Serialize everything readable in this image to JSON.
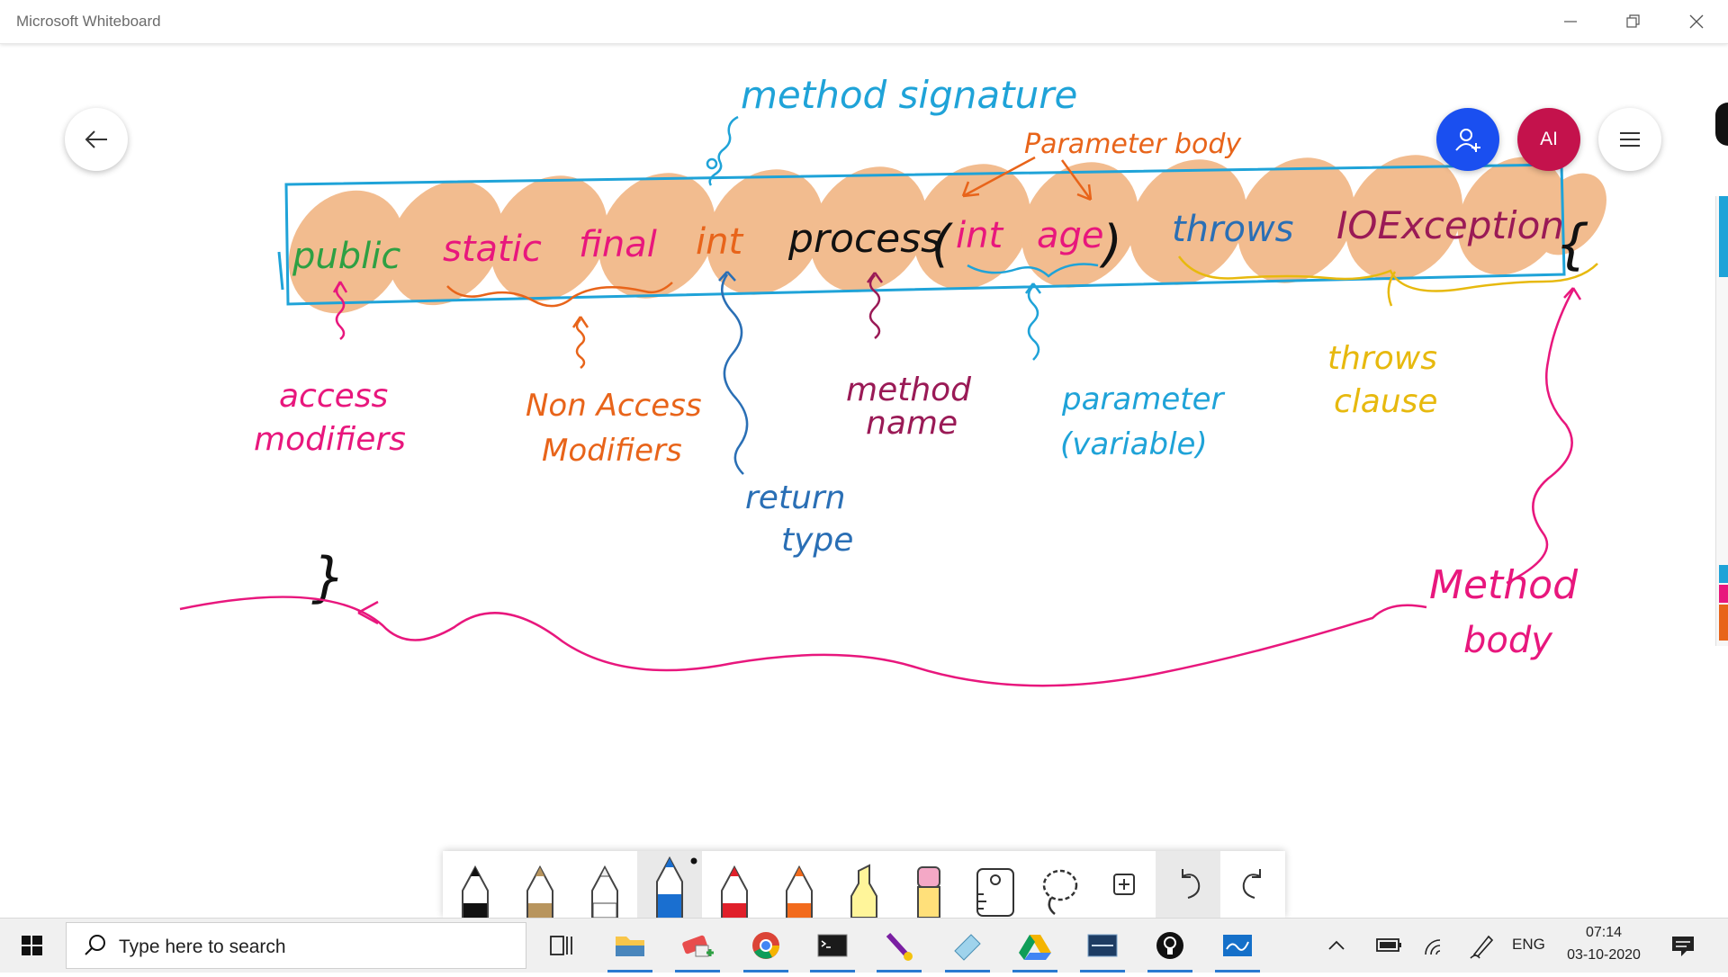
{
  "window": {
    "title": "Microsoft Whiteboard"
  },
  "whiteboard": {
    "avatar_initials": "AI",
    "colors": {
      "highlight": "#f2b98a",
      "box": "#1fa3d8",
      "green": "#2ea043",
      "magenta": "#e8177d",
      "orange": "#e8641a",
      "black": "#111111",
      "blue": "#2a6fb5",
      "purple": "#9a1a56",
      "yellow": "#e7b90e",
      "invite_button": "#1a4ff0",
      "avatar": "#c4124c"
    },
    "ink": {
      "method_signature": "method signature",
      "parameter_body": "Parameter body",
      "public": "public",
      "static": "static",
      "final": "final",
      "int": "int",
      "process": "process",
      "open_paren": "(",
      "param_int": "int",
      "param_age": "age",
      "close_paren": ")",
      "throws": "throws",
      "ioexception": "IOException",
      "open_brace": "{",
      "close_brace": "}",
      "access_1": "access",
      "access_2": "modifiers",
      "nonaccess_1": "Non Access",
      "nonaccess_2": "Modifiers",
      "return_1": "return",
      "return_2": "type",
      "methodname_1": "method",
      "methodname_2": "name",
      "parameter_1": "parameter",
      "parameter_2": "(variable)",
      "throws_1": "throws",
      "throws_2": "clause",
      "methodbody_1": "Method",
      "methodbody_2": "body"
    }
  },
  "toolbar": {
    "tools": [
      "black-pen",
      "gold-pen",
      "white-pen",
      "blue-pen",
      "red-pen",
      "orange-pen",
      "yellow-highlighter",
      "eraser",
      "ruler",
      "lasso-select",
      "add-content",
      "undo",
      "redo"
    ],
    "selected_tool": "blue-pen"
  },
  "taskbar": {
    "search_placeholder": "Type here to search",
    "apps": [
      "file-explorer",
      "paint-app",
      "chrome",
      "command-prompt",
      "snipping-tool",
      "notepad",
      "google-drive",
      "mysql",
      "lightbulb-app",
      "whiteboard"
    ],
    "language": "ENG",
    "time": "07:14",
    "date": "03-10-2020"
  }
}
